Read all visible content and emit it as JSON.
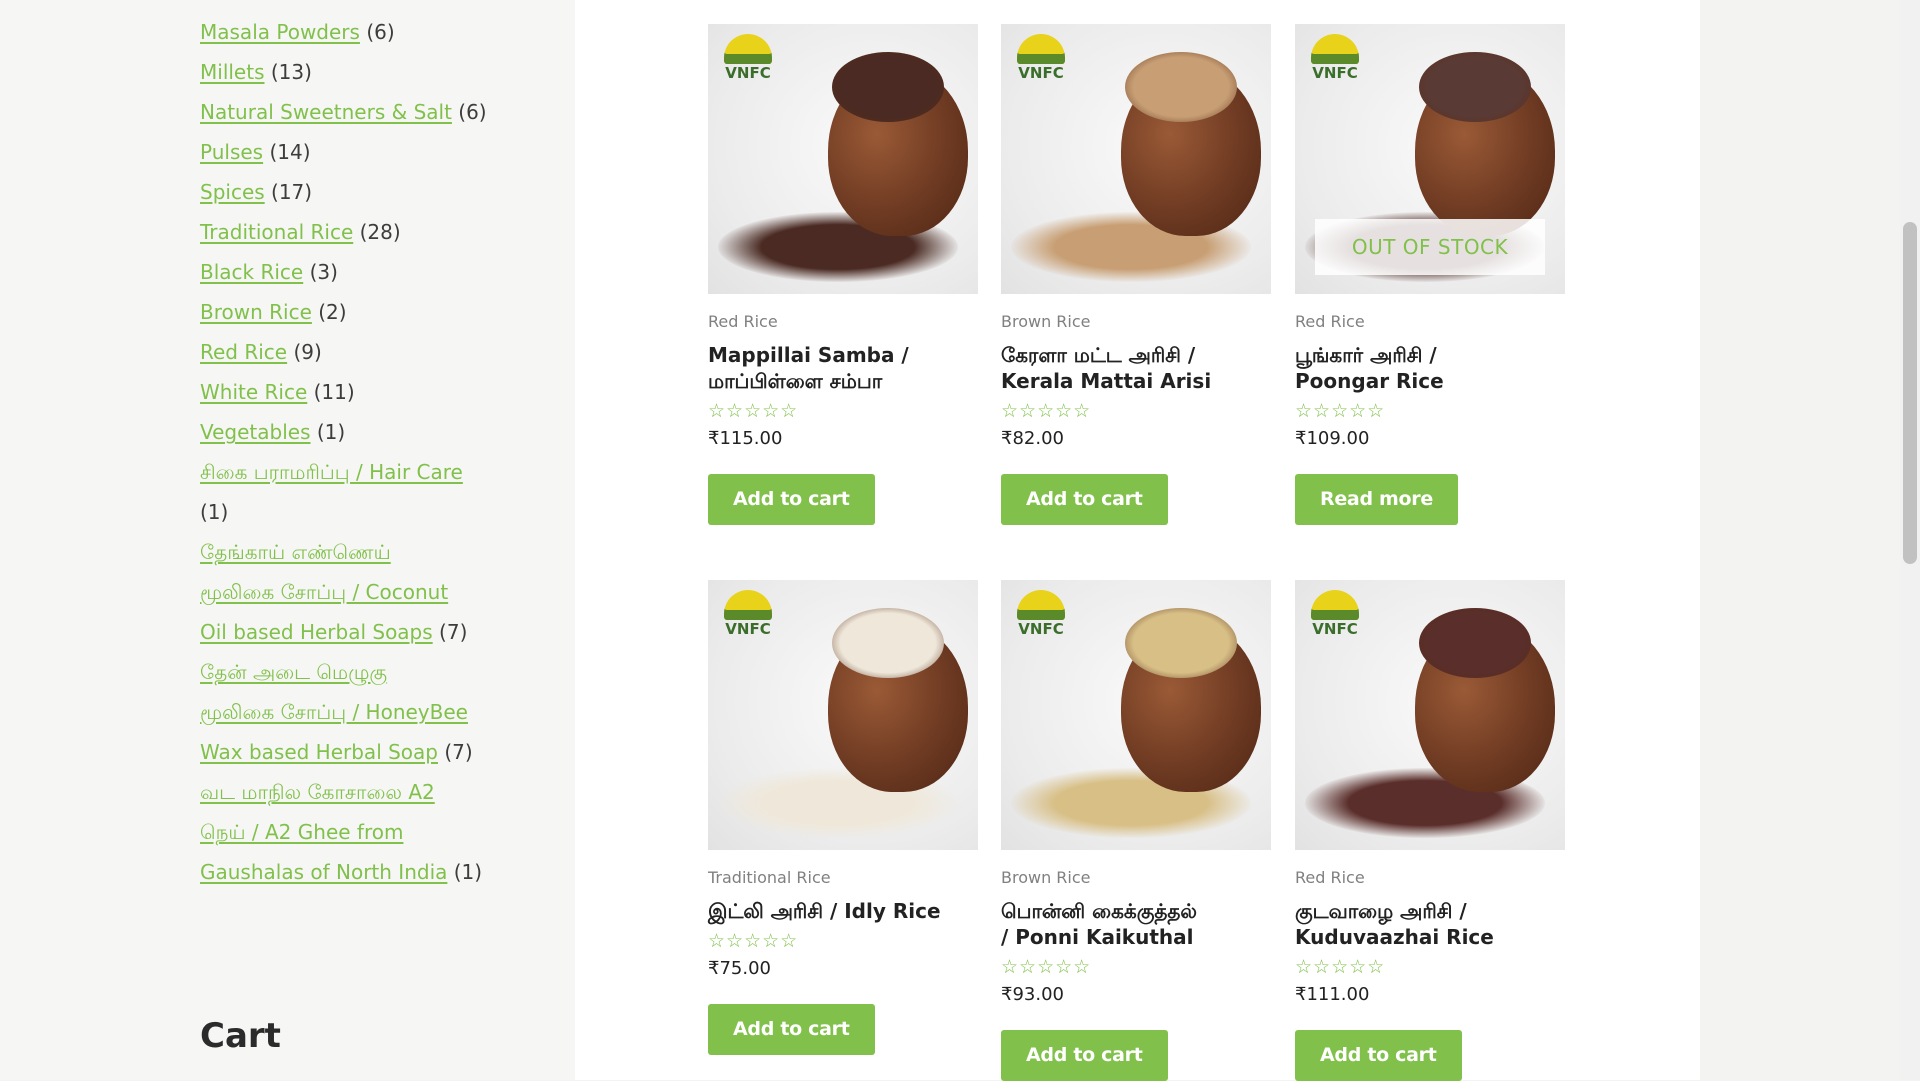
{
  "sidebar": {
    "categories": [
      {
        "label": "Masala Powders",
        "count": "(6)"
      },
      {
        "label": "Millets",
        "count": "(13)"
      },
      {
        "label": "Natural Sweetners & Salt",
        "count": "(6)"
      },
      {
        "label": "Pulses",
        "count": "(14)"
      },
      {
        "label": "Spices",
        "count": "(17)"
      },
      {
        "label": "Traditional Rice",
        "count": "(28)"
      },
      {
        "label": "Black Rice",
        "count": "(3)"
      },
      {
        "label": "Brown Rice",
        "count": "(2)"
      },
      {
        "label": "Red Rice",
        "count": "(9)"
      },
      {
        "label": "White Rice",
        "count": "(11)"
      },
      {
        "label": "Vegetables",
        "count": "(1)"
      }
    ],
    "hair_care": {
      "label": "சிகை பராமரிப்பு / Hair Care",
      "count": "(1)"
    },
    "coconut": {
      "line1": "தேங்காய் எண்ணெய்",
      "line2": "மூலிகை சோப்பு / Coconut",
      "line3": "Oil based Herbal Soaps",
      "count": "(7)"
    },
    "honeybee": {
      "line1": "தேன் அடை மெழுகு",
      "line2": "மூலிகை சோப்பு / HoneyBee",
      "line3": "Wax based Herbal Soap",
      "count": "(7)"
    },
    "ghee": {
      "line1": "வட மாநில கோசாலை A2",
      "line2": "நெய் / A2 Ghee from",
      "line3": "Gaushalas of North India",
      "count": "(1)"
    },
    "cart_title": "Cart"
  },
  "brand": {
    "logo_text": "VNFC",
    "accent": "#81c14b"
  },
  "products": [
    {
      "category": "Red Rice",
      "title_line1": "Mappillai Samba /",
      "title_line2": "மாப்பிள்ளை சம்பா",
      "rating": "☆☆☆☆☆",
      "price": "₹115.00",
      "button": "Add to cart",
      "grain_color": "#4a2a22"
    },
    {
      "category": "Brown Rice",
      "title_line1": "கேரளா மட்ட அரிசி /",
      "title_line2": "Kerala Mattai Arisi",
      "rating": "☆☆☆☆☆",
      "price": "₹82.00",
      "button": "Add to cart",
      "grain_color": "#c89f74"
    },
    {
      "category": "Red Rice",
      "title_line1": "பூங்கார் அரிசி /",
      "title_line2": "Poongar Rice",
      "rating": "☆☆☆☆☆",
      "price": "₹109.00",
      "button": "Read more",
      "badge": "OUT OF STOCK",
      "grain_color": "#5a3a34"
    },
    {
      "category": "Traditional Rice",
      "title_line1": "இட்லி அரிசி / Idly Rice",
      "title_line2": "",
      "rating": "☆☆☆☆☆",
      "price": "₹75.00",
      "button": "Add to cart",
      "grain_color": "#efe8da"
    },
    {
      "category": "Brown Rice",
      "title_line1": "பொன்னி கைக்குத்தல்",
      "title_line2": "/ Ponni Kaikuthal",
      "rating": "☆☆☆☆☆",
      "price": "₹93.00",
      "button": "Add to cart",
      "grain_color": "#d8bf86"
    },
    {
      "category": "Red Rice",
      "title_line1": "குடவாழை அரிசி /",
      "title_line2": "Kuduvaazhai Rice",
      "rating": "☆☆☆☆☆",
      "price": "₹111.00",
      "button": "Add to cart",
      "grain_color": "#5a2e2a"
    }
  ]
}
